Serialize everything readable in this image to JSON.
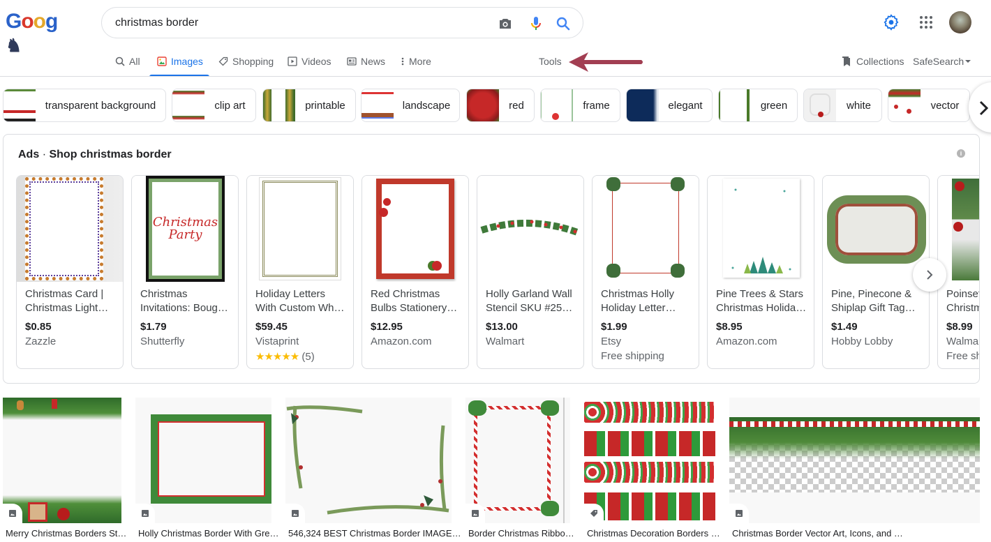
{
  "header": {
    "logo_letters": [
      "G",
      "o",
      "o",
      "g"
    ],
    "search_value": "christmas border",
    "icons": {
      "camera": "camera-icon",
      "mic": "mic-icon",
      "search": "search-icon",
      "settings": "gear-icon",
      "apps": "apps-grid-icon",
      "avatar": "avatar"
    }
  },
  "tabs": [
    {
      "label": "All",
      "icon": "search-icon",
      "active": false
    },
    {
      "label": "Images",
      "icon": "image-icon",
      "active": true
    },
    {
      "label": "Shopping",
      "icon": "tag-icon",
      "active": false
    },
    {
      "label": "Videos",
      "icon": "play-icon",
      "active": false
    },
    {
      "label": "News",
      "icon": "news-icon",
      "active": false
    },
    {
      "label": "More",
      "icon": "more-vert-icon",
      "active": false
    }
  ],
  "tools_label": "Tools",
  "collections_label": "Collections",
  "safesearch_label": "SafeSearch",
  "colors": {
    "accent": "#1a73e8",
    "annotation_arrow": "#a23e52",
    "text_muted": "#5f6368"
  },
  "chips": [
    {
      "label": "transparent background"
    },
    {
      "label": "clip art"
    },
    {
      "label": "printable"
    },
    {
      "label": "landscape"
    },
    {
      "label": "red"
    },
    {
      "label": "frame"
    },
    {
      "label": "elegant"
    },
    {
      "label": "green"
    },
    {
      "label": "white"
    },
    {
      "label": "vector"
    }
  ],
  "ads": {
    "prefix": "Ads",
    "separator": "·",
    "title": "Shop christmas border",
    "products": [
      {
        "title1": "Christmas Card |",
        "title2": "Christmas Light…",
        "price": "$0.85",
        "merchant": "Zazzle",
        "extra": ""
      },
      {
        "title1": "Christmas",
        "title2": "Invitations: Bough…",
        "price": "$1.79",
        "merchant": "Shutterfly",
        "extra": ""
      },
      {
        "title1": "Holiday Letters",
        "title2": "With Custom Whit…",
        "price": "$59.45",
        "merchant": "Vistaprint",
        "rating": 4.5,
        "stars": "★★★★★",
        "reviews": "(5)"
      },
      {
        "title1": "Red Christmas",
        "title2": "Bulbs Stationery…",
        "price": "$12.95",
        "merchant": "Amazon.com",
        "extra": ""
      },
      {
        "title1": "Holly Garland Wall",
        "title2": "Stencil SKU #256…",
        "price": "$13.00",
        "merchant": "Walmart",
        "extra": ""
      },
      {
        "title1": "Christmas Holly",
        "title2": "Holiday Letter…",
        "price": "$1.99",
        "merchant": "Etsy",
        "extra": "Free shipping"
      },
      {
        "title1": "Pine Trees & Stars",
        "title2": "Christmas Holiday…",
        "price": "$8.95",
        "merchant": "Amazon.com",
        "extra": ""
      },
      {
        "title1": "Pine, Pinecone &",
        "title2": "Shiplap Gift Tag…",
        "price": "$1.49",
        "merchant": "Hobby Lobby",
        "extra": ""
      },
      {
        "title1": "Poinsettia",
        "title2": "Christmas",
        "price": "$8.99",
        "merchant": "Walmart",
        "extra": "Free shipping"
      }
    ]
  },
  "results": [
    {
      "caption": "Merry Christmas Borders St…",
      "badge": "image-icon"
    },
    {
      "caption": "Holly Christmas Border With Gre…",
      "badge": "image-icon"
    },
    {
      "caption": "546,324 BEST Christmas Border IMAGE…",
      "badge": "image-icon"
    },
    {
      "caption": "Border Christmas Ribbo…",
      "badge": "image-icon"
    },
    {
      "caption": "Christmas Decoration Borders …",
      "badge": "tag-icon"
    },
    {
      "caption": "Christmas Border Vector Art, Icons, and …",
      "badge": "image-icon"
    }
  ]
}
